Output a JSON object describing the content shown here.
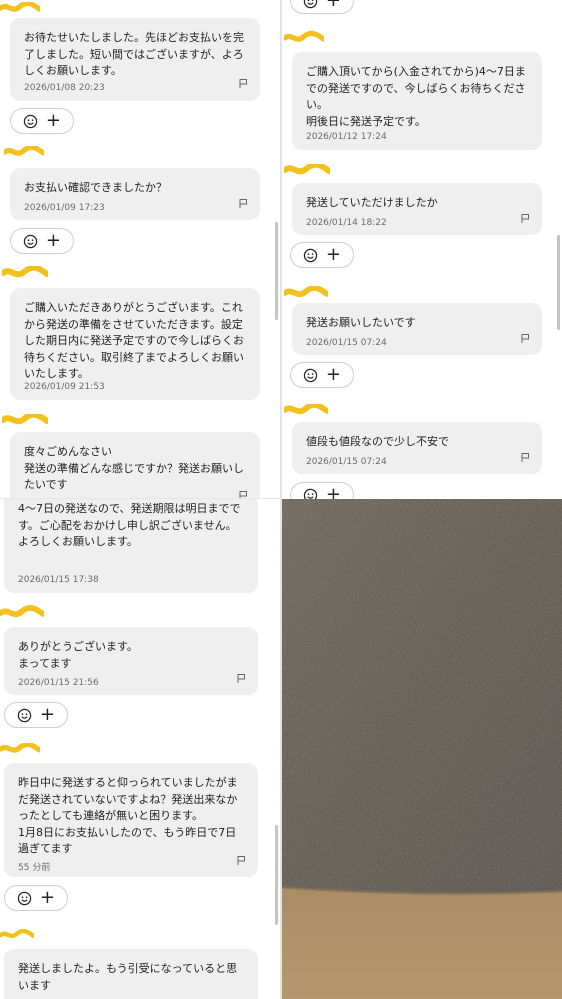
{
  "left_top": {
    "messages": [
      {
        "text": "お待たせいたしました。先ほどお支払いを完了しました。短い間ではございますが、よろしくお願いします。",
        "time": "2026/01/08 20:23"
      },
      {
        "text": "お支払い確認できましたか？",
        "time": "2026/01/09 17:23"
      },
      {
        "text": "ご購入いただきありがとうございます。これから発送の準備をさせていただきます。設定した期日内に発送予定ですので今しばらくお待ちください。取引終了までよろしくお願いいたします。",
        "time": "2026/01/09 21:53"
      },
      {
        "text": "度々ごめんなさい\n発送の準備どんな感じですか？発送お願いしたいです",
        "time": ""
      }
    ]
  },
  "right_top": {
    "messages": [
      {
        "text": "ご購入頂いてから(入金されてから)4〜7日までの発送ですので、今しばらくお待ちください。\n明後日に発送予定です。",
        "time": "2026/01/12 17:24"
      },
      {
        "text": "発送していただけましたか",
        "time": "2026/01/14 18:22"
      },
      {
        "text": "発送お願いしたいです",
        "time": "2026/01/15 07:24"
      },
      {
        "text": "値段も値段なので少し不安で",
        "time": "2026/01/15 07:24"
      }
    ]
  },
  "left_bottom": {
    "messages": [
      {
        "text": "4〜7日の発送なので、発送期限は明日までです。ご心配をおかけし申し訳ございません。\nよろしくお願いします。",
        "time": "2026/01/15 17:38"
      },
      {
        "text": "ありがとうございます。\nまってます",
        "time": "2026/01/15 21:56"
      },
      {
        "text": "昨日中に発送すると仰っられていましたがまだ発送されていないですよね？発送出来なかったとしても連絡が無いと困ります。\n1月8日にお支払いしたので、もう昨日で7日過ぎてます",
        "time": "55 分前"
      },
      {
        "text": "発送しましたよ。もう引受になっていると思います",
        "time": ""
      }
    ]
  },
  "reaction": {
    "add_label": "+"
  },
  "icons": {
    "reaction": "smile-icon",
    "report": "flag-icon"
  },
  "colors": {
    "bubble": "#efefef",
    "scribble": "#f3c01c",
    "timestamp": "#6b6b6b"
  }
}
